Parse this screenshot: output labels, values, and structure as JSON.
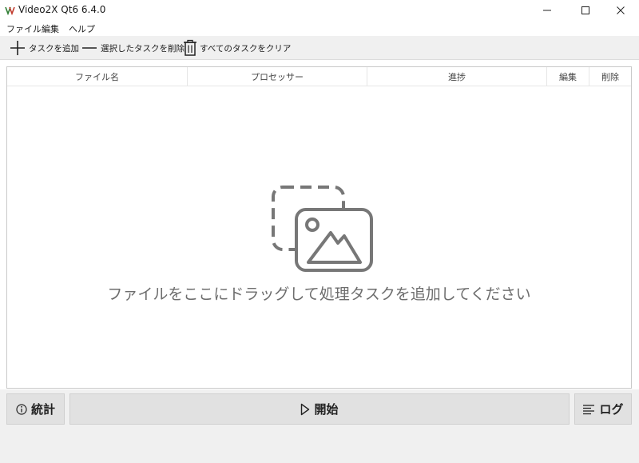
{
  "window": {
    "title": "Video2X Qt6 6.4.0",
    "minimize_glyph": "—",
    "maximize_glyph": "☐",
    "close_glyph": "✕"
  },
  "menu": {
    "items": [
      {
        "label": "ファイル"
      },
      {
        "label": "編集"
      },
      {
        "label": "ヘルプ"
      }
    ]
  },
  "toolbar": {
    "add_task": "タスクを追加",
    "remove_selected": "選択したタスクを削除",
    "clear_all": "すべてのタスクをクリア"
  },
  "table": {
    "columns": [
      "ファイル名",
      "プロセッサー",
      "進捗",
      "編集",
      "削除"
    ],
    "rows": []
  },
  "empty_state": {
    "icon": "image-placeholder-icon",
    "message": "ファイルをここにドラッグして処理タスクを追加してください"
  },
  "bottom": {
    "stats_label": "統計",
    "start_label": "開始",
    "log_label": "ログ"
  },
  "colors": {
    "accent_logo_red": "#c0392b",
    "accent_logo_green": "#2e7d32",
    "icon_gray": "#6b6b6b"
  }
}
